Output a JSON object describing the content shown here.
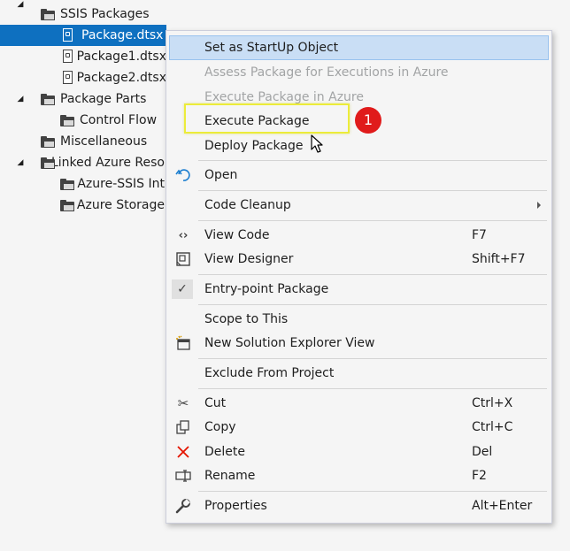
{
  "tree": {
    "items": [
      {
        "label": "SSIS Packages",
        "icon": "folder-icon",
        "expanded": true
      },
      {
        "label": "Package.dtsx",
        "icon": "ssis-package-icon",
        "selected": true
      },
      {
        "label": "Package1.dtsx",
        "icon": "ssis-package-icon"
      },
      {
        "label": "Package2.dtsx",
        "icon": "ssis-package-icon"
      },
      {
        "label": "Package Parts",
        "icon": "folder-icon",
        "expanded": true
      },
      {
        "label": "Control Flow",
        "icon": "folder-icon"
      },
      {
        "label": "Miscellaneous",
        "icon": "folder-icon"
      },
      {
        "label": "Linked Azure Reso",
        "icon": "folder-icon",
        "expanded": true
      },
      {
        "label": "Azure-SSIS Int",
        "icon": "folder-icon"
      },
      {
        "label": "Azure Storage",
        "icon": "folder-icon"
      }
    ]
  },
  "menu": {
    "items": [
      {
        "label": "Set as StartUp Object",
        "state": "highlighted"
      },
      {
        "label": "Assess Package for Executions in Azure",
        "state": "disabled"
      },
      {
        "label": "Execute Package in Azure",
        "state": "disabled"
      },
      {
        "label": "Execute Package"
      },
      {
        "label": "Deploy Package"
      },
      {
        "label": "Open",
        "icon": "undo-arrow-icon"
      },
      {
        "label": "Code Cleanup",
        "submenu": true
      },
      {
        "label": "View Code",
        "shortcut": "F7",
        "icon": "code-brackets-icon"
      },
      {
        "label": "View Designer",
        "shortcut": "Shift+F7",
        "icon": "designer-icon"
      },
      {
        "label": "Entry-point Package",
        "checked": true,
        "icon": "checkmark-icon"
      },
      {
        "label": "Scope to This"
      },
      {
        "label": "New Solution Explorer View",
        "icon": "new-window-icon"
      },
      {
        "label": "Exclude From Project"
      },
      {
        "label": "Cut",
        "shortcut": "Ctrl+X",
        "icon": "scissors-icon"
      },
      {
        "label": "Copy",
        "shortcut": "Ctrl+C",
        "icon": "copy-icon"
      },
      {
        "label": "Delete",
        "shortcut": "Del",
        "icon": "delete-x-icon"
      },
      {
        "label": "Rename",
        "shortcut": "F2",
        "icon": "rename-icon"
      },
      {
        "label": "Properties",
        "shortcut": "Alt+Enter",
        "icon": "wrench-icon"
      }
    ]
  },
  "callout": {
    "number": "1"
  },
  "colors": {
    "selection": "#0e70c0",
    "menu_highlight": "#c9def5",
    "callout_border": "#ecec3a",
    "badge": "#e01b1b",
    "delete_icon": "#e51400",
    "open_icon": "#1e7fd0"
  }
}
